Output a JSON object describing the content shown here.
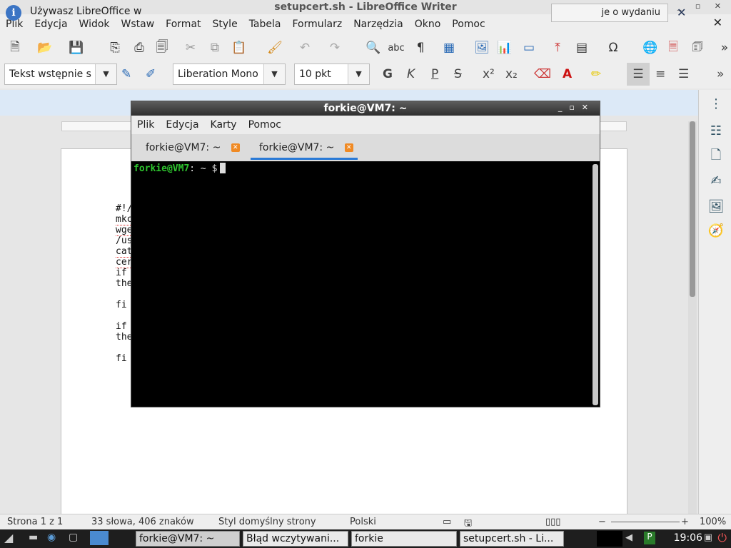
{
  "window": {
    "title": "setupcert.sh - LibreOffice Writer",
    "controls": "_ ▫ ✕"
  },
  "menubar": {
    "items": [
      "Plik",
      "Edycja",
      "Widok",
      "Wstaw",
      "Format",
      "Style",
      "Tabela",
      "Formularz",
      "Narzędzia",
      "Okno",
      "Pomoc"
    ]
  },
  "format_toolbar": {
    "paragraph_style": "Tekst wstępnie s",
    "font_name": "Liberation Mono",
    "font_size": "10 pkt",
    "bold": "G",
    "italic": "K",
    "underline": "P",
    "strike": "S"
  },
  "infobar": {
    "text": "Używasz LibreOffice w",
    "button": "je o wydaniu"
  },
  "document": {
    "lines": [
      "#!/",
      "mkc",
      "wge",
      "/us",
      "cat",
      "cer",
      "if",
      "the",
      "",
      "fi",
      "",
      "if",
      "the",
      "",
      "fi"
    ]
  },
  "terminal": {
    "title": "forkie@VM7: ~",
    "menu": [
      "Plik",
      "Edycja",
      "Karty",
      "Pomoc"
    ],
    "tabs": [
      {
        "label": "forkie@VM7: ~",
        "active": false
      },
      {
        "label": "forkie@VM7: ~",
        "active": true
      }
    ],
    "prompt_user": "forkie@VM7",
    "prompt_rest": ": ~ $"
  },
  "statusbar": {
    "page": "Strona 1 z 1",
    "words": "33 słowa, 406 znaków",
    "page_style": "Styl domyślny strony",
    "language": "Polski",
    "zoom": "100%"
  },
  "taskbar": {
    "tasks": [
      "forkie@VM7: ~",
      "Błąd wczytywani...",
      "forkie",
      "setupcert.sh - Li..."
    ],
    "clock": "19:06"
  },
  "colors": {
    "accent": "#2a7ad6",
    "prompt_green": "#2ec52e",
    "infobar_bg": "#dce9f7"
  }
}
